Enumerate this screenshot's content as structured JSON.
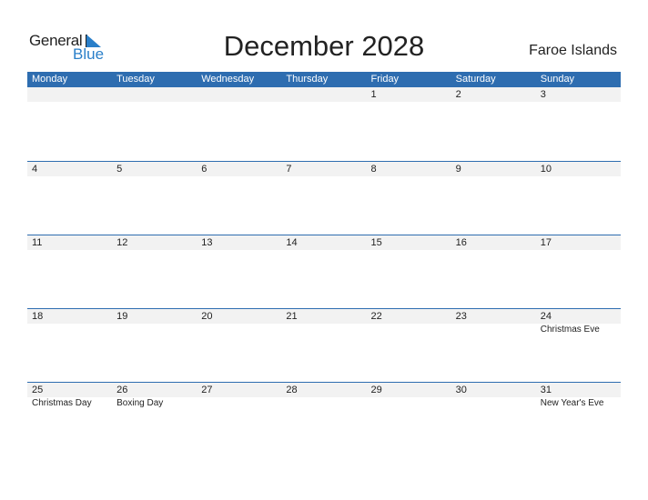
{
  "logo": {
    "part1": "General",
    "part2": "Blue"
  },
  "title": "December 2028",
  "region": "Faroe Islands",
  "colors": {
    "header_bg": "#2e6db0",
    "date_strip": "#f2f2f2",
    "logo_blue": "#2a7fc9"
  },
  "weekdays": [
    "Monday",
    "Tuesday",
    "Wednesday",
    "Thursday",
    "Friday",
    "Saturday",
    "Sunday"
  ],
  "weeks": [
    {
      "dates": [
        "",
        "",
        "",
        "",
        "1",
        "2",
        "3"
      ],
      "events": [
        "",
        "",
        "",
        "",
        "",
        "",
        ""
      ]
    },
    {
      "dates": [
        "4",
        "5",
        "6",
        "7",
        "8",
        "9",
        "10"
      ],
      "events": [
        "",
        "",
        "",
        "",
        "",
        "",
        ""
      ]
    },
    {
      "dates": [
        "11",
        "12",
        "13",
        "14",
        "15",
        "16",
        "17"
      ],
      "events": [
        "",
        "",
        "",
        "",
        "",
        "",
        ""
      ]
    },
    {
      "dates": [
        "18",
        "19",
        "20",
        "21",
        "22",
        "23",
        "24"
      ],
      "events": [
        "",
        "",
        "",
        "",
        "",
        "",
        "Christmas Eve"
      ]
    },
    {
      "dates": [
        "25",
        "26",
        "27",
        "28",
        "29",
        "30",
        "31"
      ],
      "events": [
        "Christmas Day",
        "Boxing Day",
        "",
        "",
        "",
        "",
        "New Year's Eve"
      ]
    }
  ]
}
